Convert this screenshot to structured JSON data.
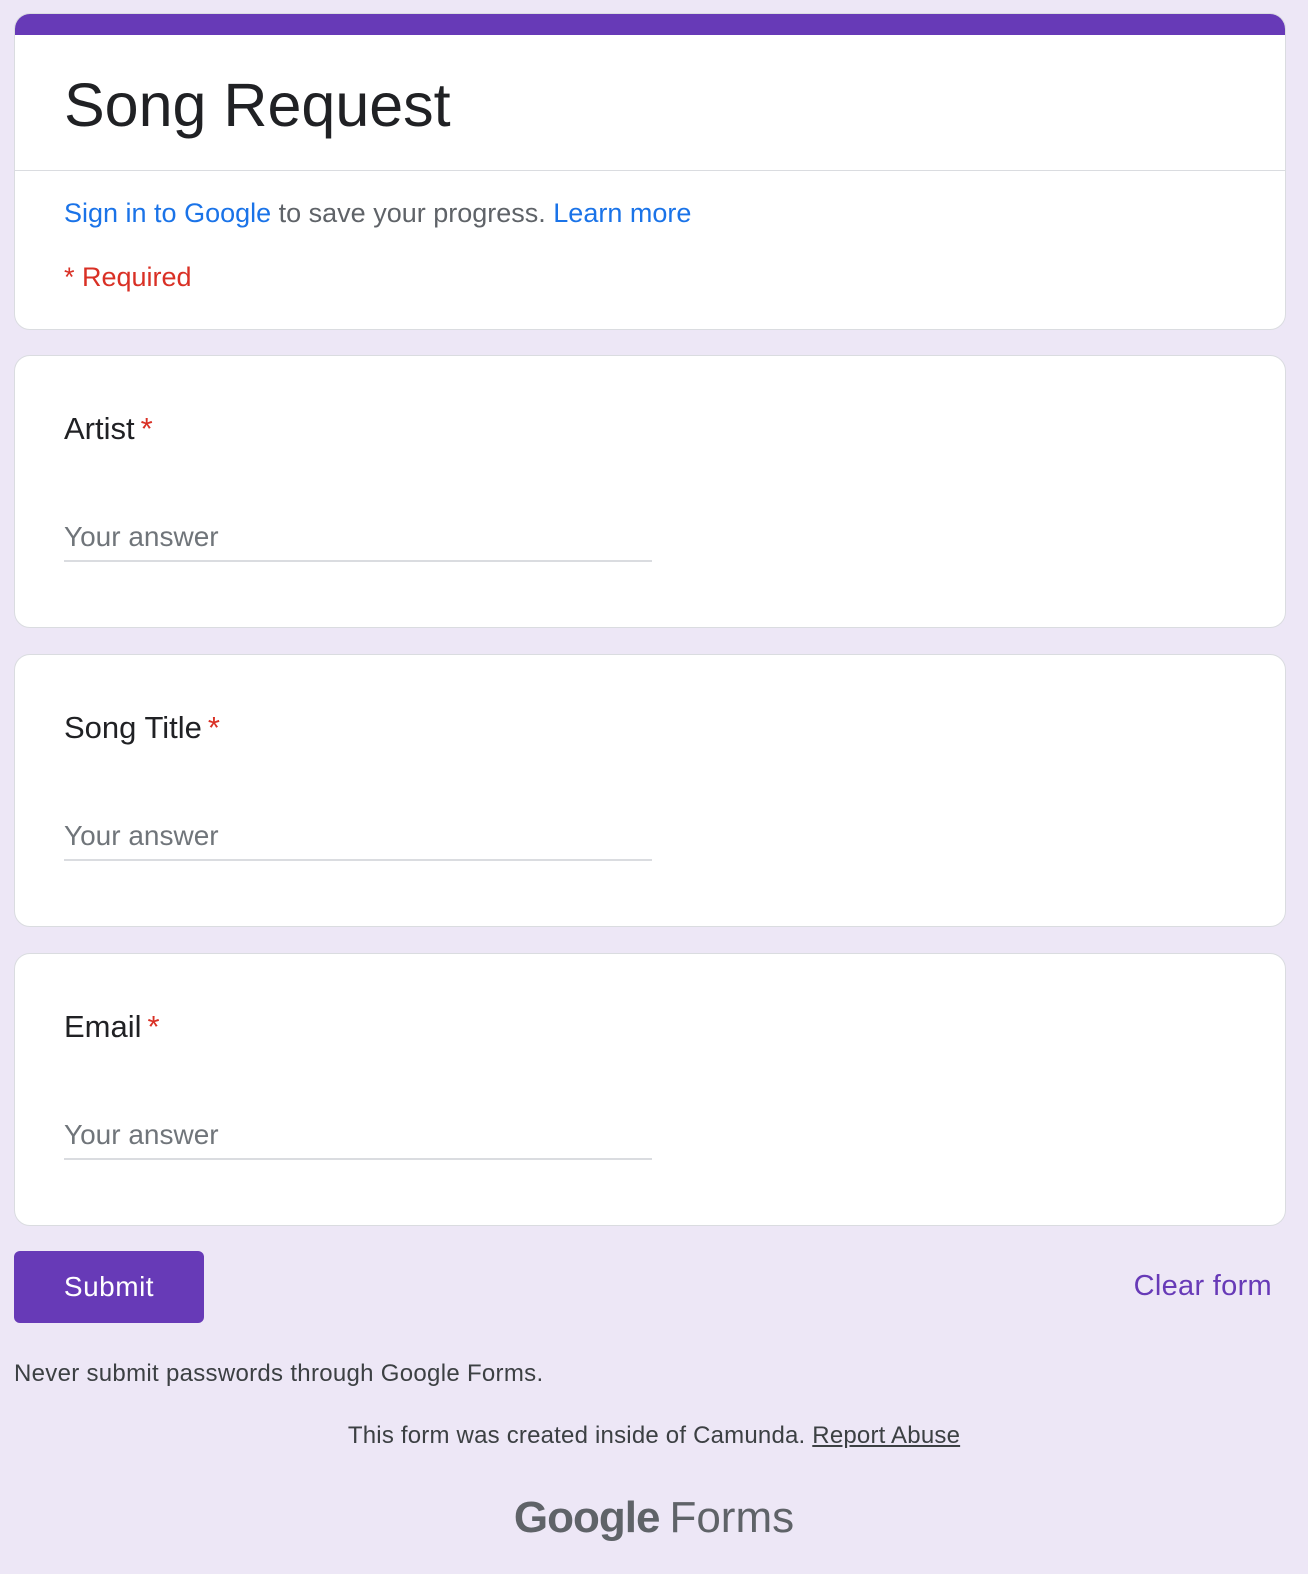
{
  "form": {
    "title": "Song Request",
    "signin_link": "Sign in to Google",
    "signin_text": " to save your progress. ",
    "learn_more": "Learn more",
    "required_note": "* Required"
  },
  "questions": [
    {
      "label": "Artist",
      "required_mark": "*",
      "placeholder": "Your answer",
      "value": ""
    },
    {
      "label": "Song Title",
      "required_mark": "*",
      "placeholder": "Your answer",
      "value": ""
    },
    {
      "label": "Email",
      "required_mark": "*",
      "placeholder": "Your answer",
      "value": ""
    }
  ],
  "actions": {
    "submit_label": "Submit",
    "clear_label": "Clear form"
  },
  "footer": {
    "warning": "Never submit passwords through Google Forms.",
    "created_text": "This form was created inside of Camunda. ",
    "report_abuse": "Report Abuse",
    "brand_google": "Google",
    "brand_forms": "Forms"
  },
  "colors": {
    "accent": "#673ab7",
    "background": "#ede7f6",
    "link": "#1a73e8",
    "required": "#d93025"
  }
}
